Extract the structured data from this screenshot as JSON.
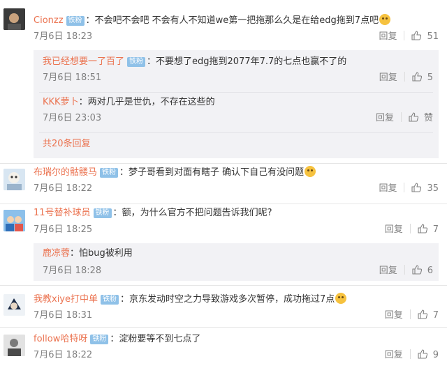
{
  "badge_label": "铁粉",
  "reply_label": "回复",
  "comments": [
    {
      "user": "Cionzz",
      "text": "不会吧不会吧 不会有人不知道we第一把拖那么久是在给edg拖到7点吧",
      "time": "7月6日 18:23",
      "likes": "51",
      "replies": [
        {
          "user": "我已经想要一了百了",
          "text": "不要想了edg拖到2077年7.7的七点也赢不了的",
          "time": "7月6日 18:51",
          "likes": "5"
        },
        {
          "user": "KKK萝卜",
          "text": "两对几乎是世仇，不存在这些的",
          "time": "7月6日 23:03",
          "likes": "赞"
        }
      ],
      "more_replies": "共20条回复"
    },
    {
      "user": "布瑞尔的骷髅马",
      "text": "梦子哥看到对面有瞎子 确认下自己有没问题",
      "time": "7月6日 18:22",
      "likes": "35"
    },
    {
      "user": "11号替补球员",
      "text": "额，为什么官方不把问题告诉我们呢?",
      "time": "7月6日 18:25",
      "likes": "7",
      "replies": [
        {
          "user": "鹿凉蓉",
          "text": "怕bug被利用",
          "time": "7月6日 18:28",
          "likes": "6"
        }
      ]
    },
    {
      "user": "我教xiye打中单",
      "text": "京东发动时空之力导致游戏多次暂停，成功拖过7点",
      "time": "7月6日 18:31",
      "likes": "7"
    },
    {
      "user": "follow哈特呀",
      "text": "淀粉要等不到七点了",
      "time": "7月6日 18:22",
      "likes": "9"
    }
  ]
}
